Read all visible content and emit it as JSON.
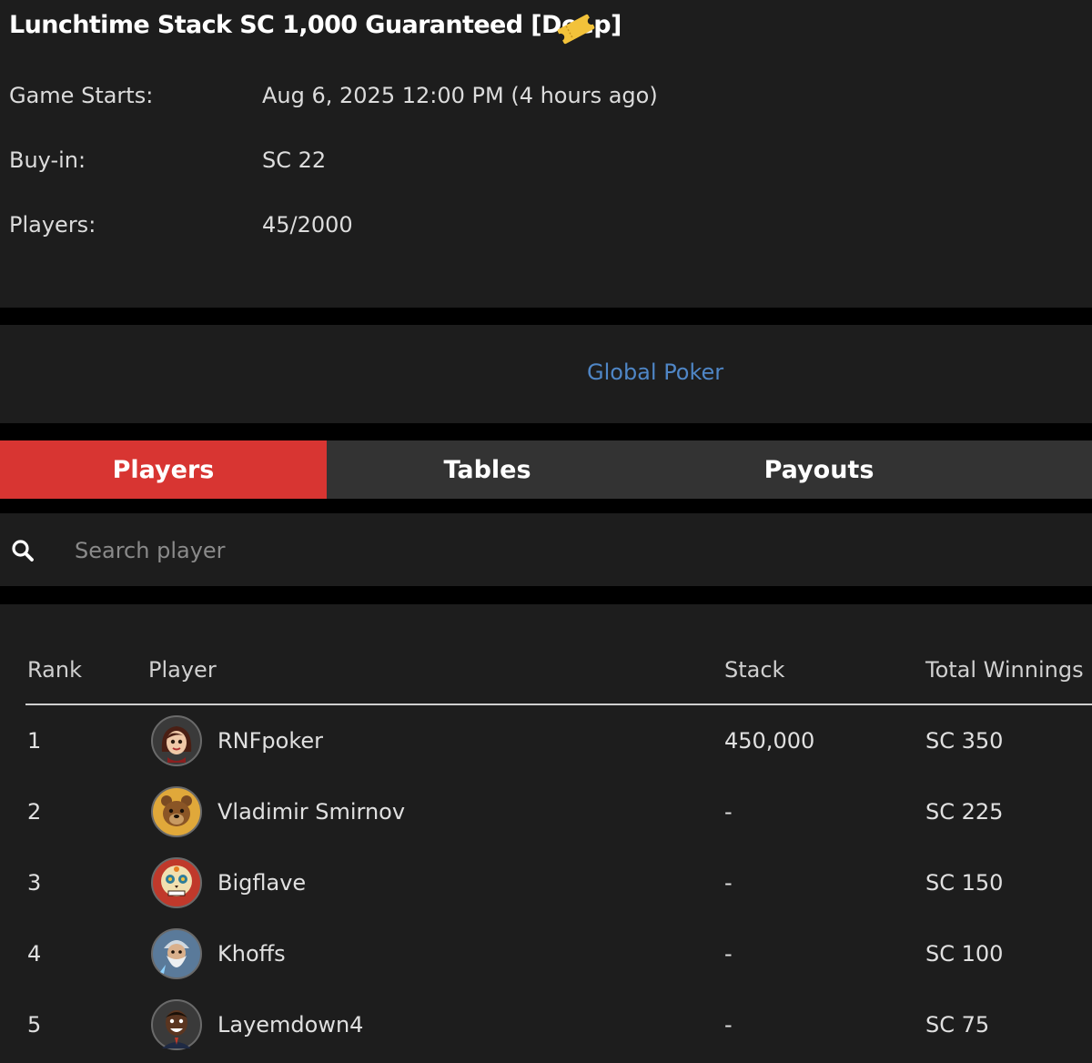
{
  "header": {
    "title": "Lunchtime Stack SC 1,000 Guaranteed [Deep]",
    "ticket_icon": "ticket-icon"
  },
  "info": {
    "game_starts_label": "Game Starts:",
    "game_starts_value": "Aug 6, 2025 12:00 PM (4 hours ago)",
    "buyin_label": "Buy-in:",
    "buyin_value": "SC 22",
    "players_label": "Players:",
    "players_value": "45/2000"
  },
  "brand": {
    "link": "Global Poker",
    "link_color": "#4f86c6"
  },
  "tabs": [
    {
      "label": "Players",
      "active": true
    },
    {
      "label": "Tables",
      "active": false
    },
    {
      "label": "Payouts",
      "active": false
    }
  ],
  "accent_color": "#d83532",
  "search": {
    "placeholder": "Search player",
    "value": "",
    "icon": "search-icon"
  },
  "table": {
    "columns": [
      "Rank",
      "Player",
      "Stack",
      "Total Winnings"
    ],
    "rows": [
      {
        "rank": "1",
        "player": "RNFpoker",
        "stack": "450,000",
        "winnings": "SC 350",
        "avatar": "woman-avatar-icon"
      },
      {
        "rank": "2",
        "player": "Vladimir Smirnov",
        "stack": "-",
        "winnings": "SC 225",
        "avatar": "bear-avatar-icon"
      },
      {
        "rank": "3",
        "player": "Bigflave",
        "stack": "-",
        "winnings": "SC 150",
        "avatar": "sugar-skull-avatar-icon"
      },
      {
        "rank": "4",
        "player": "Khoffs",
        "stack": "-",
        "winnings": "SC 100",
        "avatar": "wizard-avatar-icon"
      },
      {
        "rank": "5",
        "player": "Layemdown4",
        "stack": "-",
        "winnings": "SC 75",
        "avatar": "man-avatar-icon"
      }
    ]
  }
}
